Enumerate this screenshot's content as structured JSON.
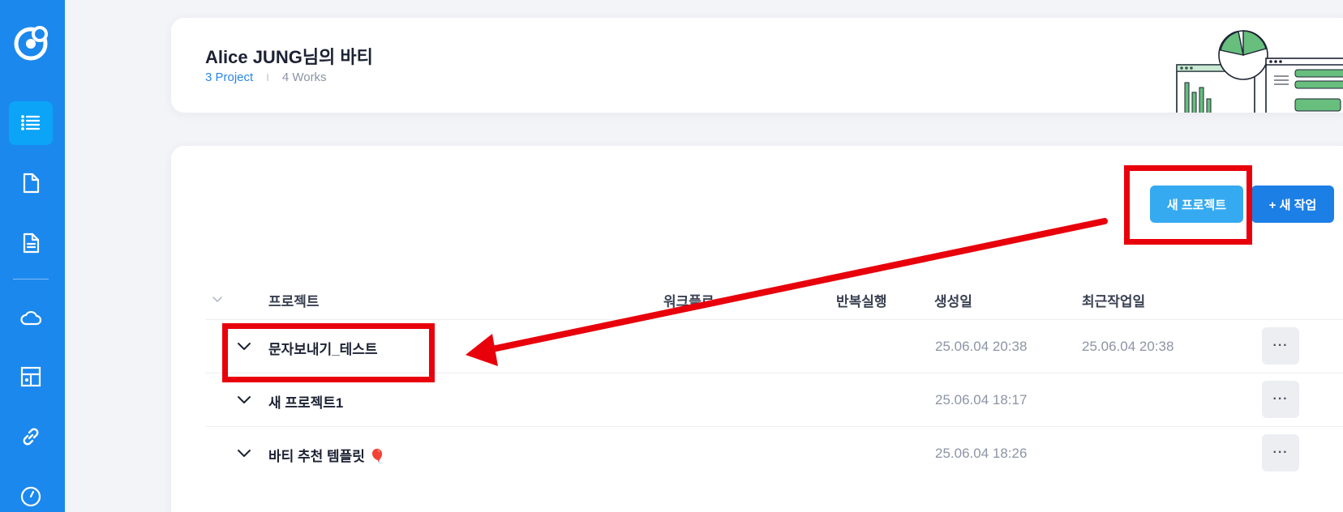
{
  "sidebar": {
    "brand_color": "#1b88ee",
    "active_color": "#0ca4f7",
    "items": [
      {
        "icon": "list-icon",
        "active": true
      },
      {
        "icon": "page-icon",
        "active": false
      },
      {
        "icon": "document-icon",
        "active": false
      },
      {
        "icon": "cloud-icon",
        "active": false
      },
      {
        "icon": "layout-icon",
        "active": false
      },
      {
        "icon": "link-icon",
        "active": false
      },
      {
        "icon": "gauge-icon",
        "active": false
      }
    ]
  },
  "header": {
    "title": "Alice JUNG님의 바티",
    "project_count": "3 Project",
    "separator": "I",
    "work_count": "4 Works"
  },
  "toolbar": {
    "new_project_label": "새 프로젝트",
    "new_work_label": "+ 새 작업"
  },
  "table": {
    "headers": {
      "project": "프로젝트",
      "workflow": "워크플로",
      "repeat": "반복실행",
      "created": "생성일",
      "recent": "최근작업일"
    },
    "rows": [
      {
        "name": "문자보내기_테스트",
        "created": "25.06.04 20:38",
        "recent": "25.06.04 20:38",
        "more": "···"
      },
      {
        "name": "새 프로젝트1",
        "created": "25.06.04 18:17",
        "recent": "",
        "more": "···"
      },
      {
        "name": "바티 추천 템플릿 🎈",
        "created": "25.06.04 18:26",
        "recent": "",
        "more": "···"
      }
    ]
  },
  "annotation": {
    "color": "#e8000b"
  }
}
